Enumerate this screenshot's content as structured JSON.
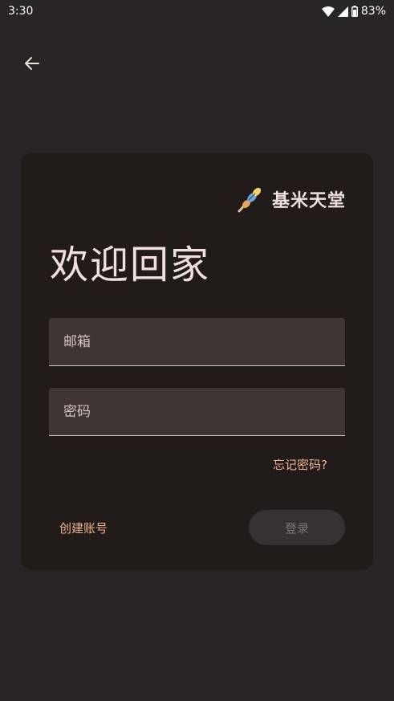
{
  "status_bar": {
    "time": "3:30",
    "battery_percent": "83%",
    "icons": [
      "wifi-icon",
      "signal-icon",
      "battery-icon"
    ]
  },
  "nav": {
    "back_icon": "arrow-left-icon"
  },
  "brand": {
    "name": "基米天堂",
    "logo_icon": "skewer-logo-icon"
  },
  "login": {
    "title": "欢迎回家",
    "email_placeholder": "邮箱",
    "password_placeholder": "密码",
    "forgot_label": "忘记密码?",
    "create_account_label": "创建账号",
    "login_label": "登录"
  },
  "colors": {
    "background": "#292426",
    "card": "#211b1a",
    "field": "#3f3633",
    "accent_link": "#f0b391",
    "disabled_button": "#373231"
  }
}
